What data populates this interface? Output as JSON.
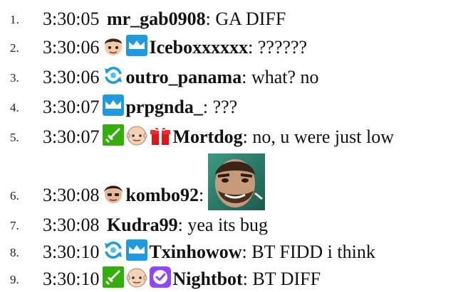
{
  "chat": {
    "messages": [
      {
        "index": "1.",
        "time": "3:30:05",
        "user": "mr_gab0908",
        "sep": ":",
        "text": " GA DIFF",
        "badges": []
      },
      {
        "index": "2.",
        "time": "3:30:06",
        "user": "Iceboxxxxxx",
        "sep": ":",
        "text": " ??????",
        "badges": [
          "avatar-icon",
          "crown-sub-icon"
        ]
      },
      {
        "index": "3.",
        "time": "3:30:06",
        "user": "outro_panama",
        "sep": ":",
        "text": " what? no",
        "badges": [
          "refresh-icon"
        ]
      },
      {
        "index": "4.",
        "time": "3:30:07",
        "user": "prpgnda_",
        "sep": ":",
        "text": " ???",
        "badges": [
          "crown-sub-icon"
        ]
      },
      {
        "index": "5.",
        "time": "3:30:07",
        "user": "Mortdog",
        "sep": ":",
        "text": " no, u were just low",
        "badges": [
          "sword-icon",
          "bald-face-icon",
          "gift-icon"
        ]
      },
      {
        "index": "6.",
        "time": "3:30:08",
        "user": "kombo92",
        "sep": ":",
        "text": "",
        "badges": [
          "dark-hair-face-icon"
        ],
        "emote": "face-emote"
      },
      {
        "index": "7.",
        "time": "3:30:08",
        "user": "Kudra99",
        "sep": ":",
        "text": " yea its bug",
        "badges": []
      },
      {
        "index": "8.",
        "time": "3:30:10",
        "user": "Txinhowow",
        "sep": ":",
        "text": " BT FIDD i think",
        "badges": [
          "refresh-icon",
          "crown-sub-icon"
        ]
      },
      {
        "index": "9.",
        "time": "3:30:10",
        "user": "Nightbot",
        "sep": ":",
        "text": " BT DIFF",
        "badges": [
          "sword-icon",
          "bald-face-icon",
          "verified-icon"
        ]
      }
    ]
  },
  "colors": {
    "text": "#111111",
    "sub_blue": "#1e9be0",
    "mod_green": "#34ae0a",
    "gift_red": "#e0151c",
    "verified_purple": "#9146ff"
  }
}
